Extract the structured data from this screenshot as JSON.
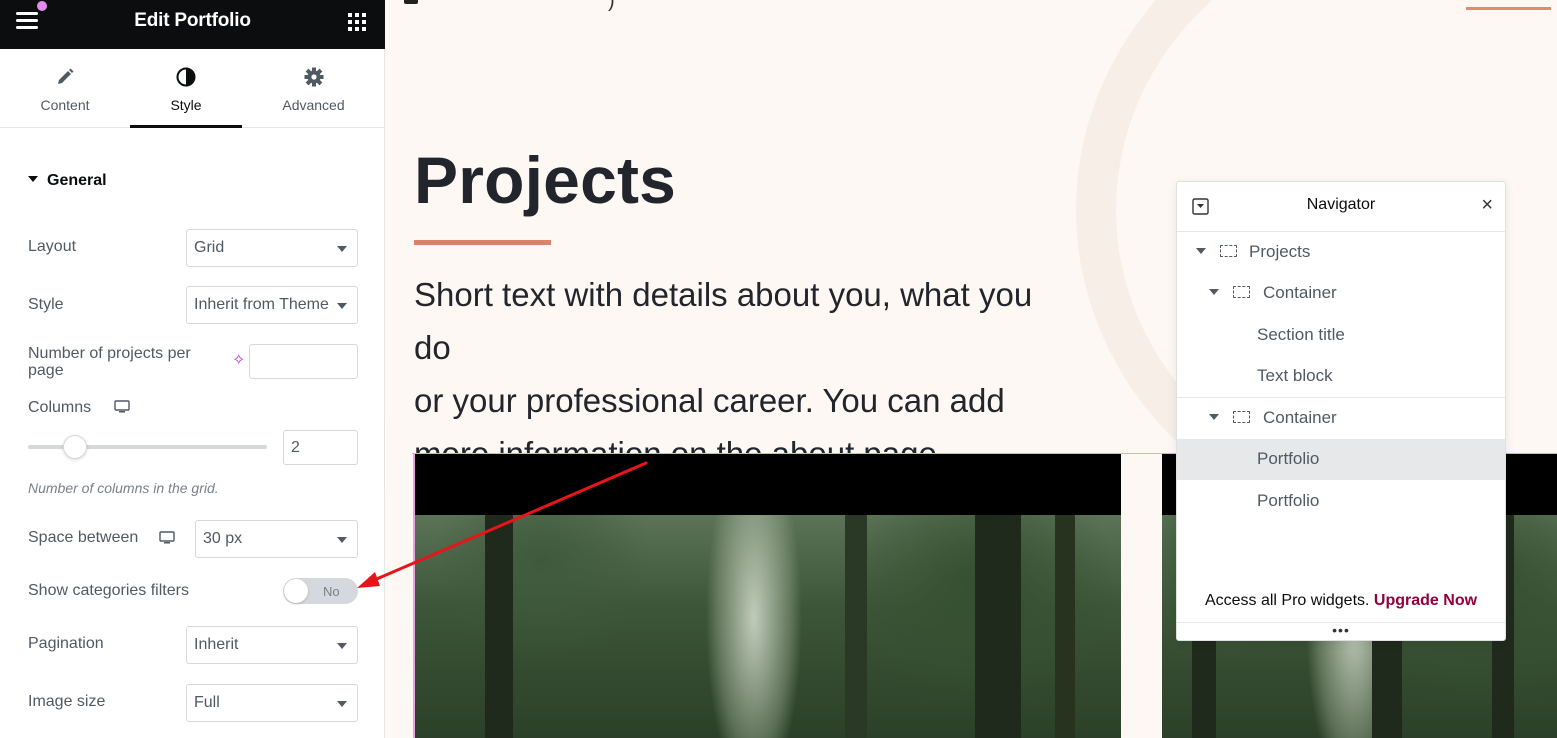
{
  "header": {
    "title": "Edit Portfolio"
  },
  "tabs": [
    {
      "label": "Content",
      "icon": "pencil-icon"
    },
    {
      "label": "Style",
      "icon": "contrast-icon"
    },
    {
      "label": "Advanced",
      "icon": "gear-icon"
    }
  ],
  "section": {
    "title": "General"
  },
  "controls": {
    "layout": {
      "label": "Layout",
      "value": "Grid"
    },
    "style": {
      "label": "Style",
      "value": "Inherit from Theme"
    },
    "projects_per_page": {
      "label": "Number of projects per page",
      "value": ""
    },
    "columns": {
      "label": "Columns",
      "value": "2",
      "help": "Number of columns in the grid.",
      "slider_value": 2
    },
    "space_between": {
      "label": "Space between",
      "value": "30 px"
    },
    "categories_filters": {
      "label": "Show categories filters",
      "toggle_text": "No",
      "on": false
    },
    "pagination": {
      "label": "Pagination",
      "value": "Inherit"
    },
    "image_size": {
      "label": "Image size",
      "value": "Full"
    }
  },
  "canvas": {
    "heading": "Projects",
    "intro_line1": "Short text with details about you, what you do",
    "intro_line2": "or your professional career. You can add",
    "intro_line3": "more information on the about page."
  },
  "navigator": {
    "title": "Navigator",
    "items": [
      {
        "label": "Projects"
      },
      {
        "label": "Container"
      },
      {
        "label": "Section title"
      },
      {
        "label": "Text block"
      },
      {
        "label": "Container"
      },
      {
        "label": "Portfolio"
      },
      {
        "label": "Portfolio"
      }
    ],
    "footer_text": "Access all Pro widgets.",
    "upgrade_label": "Upgrade Now",
    "resize_glyph": "•••"
  },
  "colors": {
    "accent_underline": "#d9826c",
    "upgrade_link": "#93003c",
    "annotation_arrow": "#e8141b",
    "selection_outline": "#e6a3e0"
  }
}
